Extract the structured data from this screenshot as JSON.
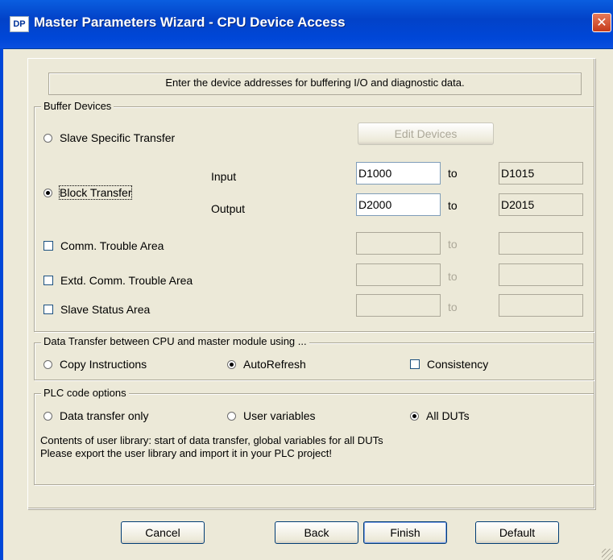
{
  "window": {
    "icon_text": "DP",
    "title": "Master Parameters Wizard - CPU Device Access",
    "close_symbol": "✕"
  },
  "banner": "Enter the device addresses for buffering I/O and diagnostic data.",
  "buffer_devices": {
    "legend": "Buffer Devices",
    "slave_specific_transfer": "Slave Specific Transfer",
    "edit_devices_button": "Edit Devices",
    "block_transfer": "Block Transfer",
    "input_label": "Input",
    "output_label": "Output",
    "input_start": "D1000",
    "input_end": "D1015",
    "output_start": "D2000",
    "output_end": "D2015",
    "to_label": "to",
    "comm_trouble_area": "Comm. Trouble Area",
    "extd_comm_trouble_area": "Extd. Comm. Trouble Area",
    "slave_status_area": "Slave Status Area",
    "selected": "block_transfer"
  },
  "data_transfer": {
    "legend": "Data Transfer between CPU and master module using ...",
    "copy_instructions": "Copy Instructions",
    "autorefresh": "AutoRefresh",
    "consistency": "Consistency",
    "selected": "autorefresh"
  },
  "plc_code": {
    "legend": "PLC code options",
    "data_transfer_only": "Data transfer only",
    "user_variables": "User variables",
    "all_duts": "All DUTs",
    "selected": "all_duts",
    "note_line1": "Contents of user library: start of data transfer, global variables for all DUTs",
    "note_line2": "Please export the user library and import it in your PLC project!"
  },
  "buttons": {
    "cancel": "Cancel",
    "back": "Back",
    "finish": "Finish",
    "default": "Default"
  },
  "colors": {
    "titlebar": "#0047d8",
    "dialog_bg": "#ece9d8",
    "close_button": "#c43a1a"
  }
}
